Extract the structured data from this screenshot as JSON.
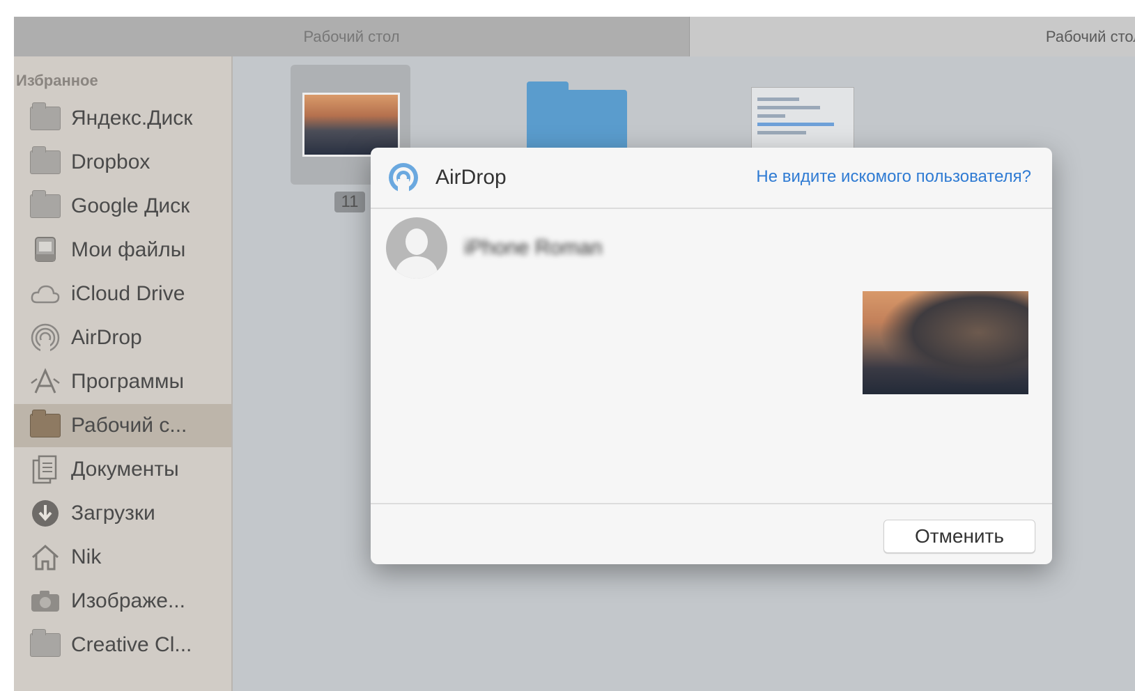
{
  "tabs": [
    {
      "label": "Рабочий стол"
    },
    {
      "label": "Рабочий стол"
    }
  ],
  "sidebar": {
    "heading": "Избранное",
    "items": [
      {
        "label": "Яндекс.Диск",
        "icon": "folder-icon"
      },
      {
        "label": "Dropbox",
        "icon": "folder-icon"
      },
      {
        "label": "Google Диск",
        "icon": "folder-icon"
      },
      {
        "label": "Мои файлы",
        "icon": "all-files-icon"
      },
      {
        "label": "iCloud Drive",
        "icon": "cloud-icon"
      },
      {
        "label": "AirDrop",
        "icon": "airdrop-icon"
      },
      {
        "label": "Программы",
        "icon": "applications-icon"
      },
      {
        "label": "Рабочий с...",
        "icon": "desktop-folder-icon",
        "selected": true
      },
      {
        "label": "Документы",
        "icon": "documents-icon"
      },
      {
        "label": "Загрузки",
        "icon": "downloads-icon"
      },
      {
        "label": "Nik",
        "icon": "home-icon"
      },
      {
        "label": "Изображе...",
        "icon": "camera-icon"
      },
      {
        "label": "Creative Cl...",
        "icon": "folder-icon"
      }
    ]
  },
  "content": {
    "files": [
      {
        "label": "11",
        "icon": "image-file-icon",
        "selected": true
      },
      {
        "label": "",
        "icon": "folder-icon"
      },
      {
        "label": "",
        "icon": "screenshot-file-icon"
      }
    ]
  },
  "dialog": {
    "title": "AirDrop",
    "help_link": "Не видите искомого пользователя?",
    "recipient_name": "iPhone Roman",
    "cancel_label": "Отменить",
    "accent_color": "#2f7bd3"
  }
}
